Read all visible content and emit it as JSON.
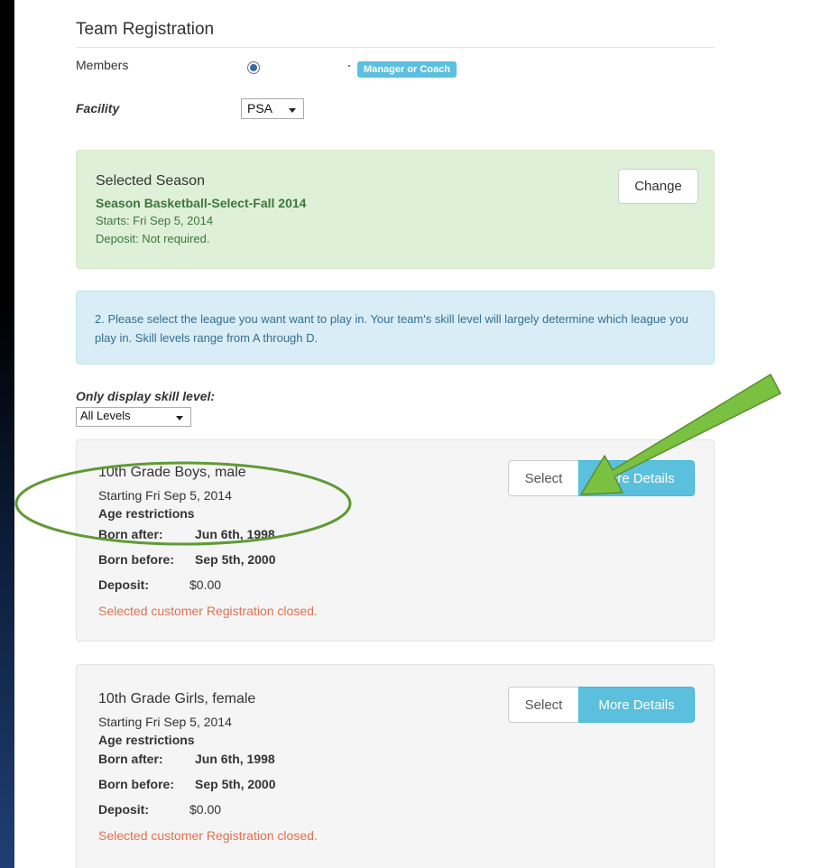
{
  "header": {
    "title": "Team Registration"
  },
  "members": {
    "label": "Members",
    "role_badge": "Manager or Coach"
  },
  "facility": {
    "label": "Facility",
    "value": "PSA"
  },
  "selected_season": {
    "heading": "Selected Season",
    "name": "Season Basketball-Select-Fall 2014",
    "starts": "Starts: Fri Sep 5, 2014",
    "deposit": "Deposit: Not required.",
    "change_label": "Change"
  },
  "instructions": "2. Please select the league you want want to play in. Your team's skill level will largely determine which league you play in. Skill levels range from A through D.",
  "filter": {
    "label": "Only display skill level:",
    "value": "All Levels"
  },
  "leagues": [
    {
      "name": "10th Grade Boys, male",
      "starting": "Starting Fri Sep 5, 2014",
      "age_heading": "Age restrictions",
      "born_after_label": "Born after:",
      "born_after": "Jun 6th, 1998",
      "born_before_label": "Born before:",
      "born_before": "Sep 5th, 2000",
      "deposit_label": "Deposit:",
      "deposit": "$0.00",
      "status": "Selected customer Registration closed.",
      "select_label": "Select",
      "details_label": "More Details"
    },
    {
      "name": "10th Grade Girls, female",
      "starting": "Starting Fri Sep 5, 2014",
      "age_heading": "Age restrictions",
      "born_after_label": "Born after:",
      "born_after": "Jun 6th, 1998",
      "born_before_label": "Born before:",
      "born_before": "Sep 5th, 2000",
      "deposit_label": "Deposit:",
      "deposit": "$0.00",
      "status": "Selected customer Registration closed.",
      "select_label": "Select",
      "details_label": "More Details"
    }
  ],
  "colors": {
    "info_button": "#5bc0de",
    "success_bg": "#dff0d8",
    "info_bg": "#d9edf7",
    "warning_text": "#e07050",
    "annotation_green": "#7ac142"
  },
  "annotations": {
    "arrow": "green-arrow-icon",
    "circle": "green-ellipse-highlight"
  }
}
